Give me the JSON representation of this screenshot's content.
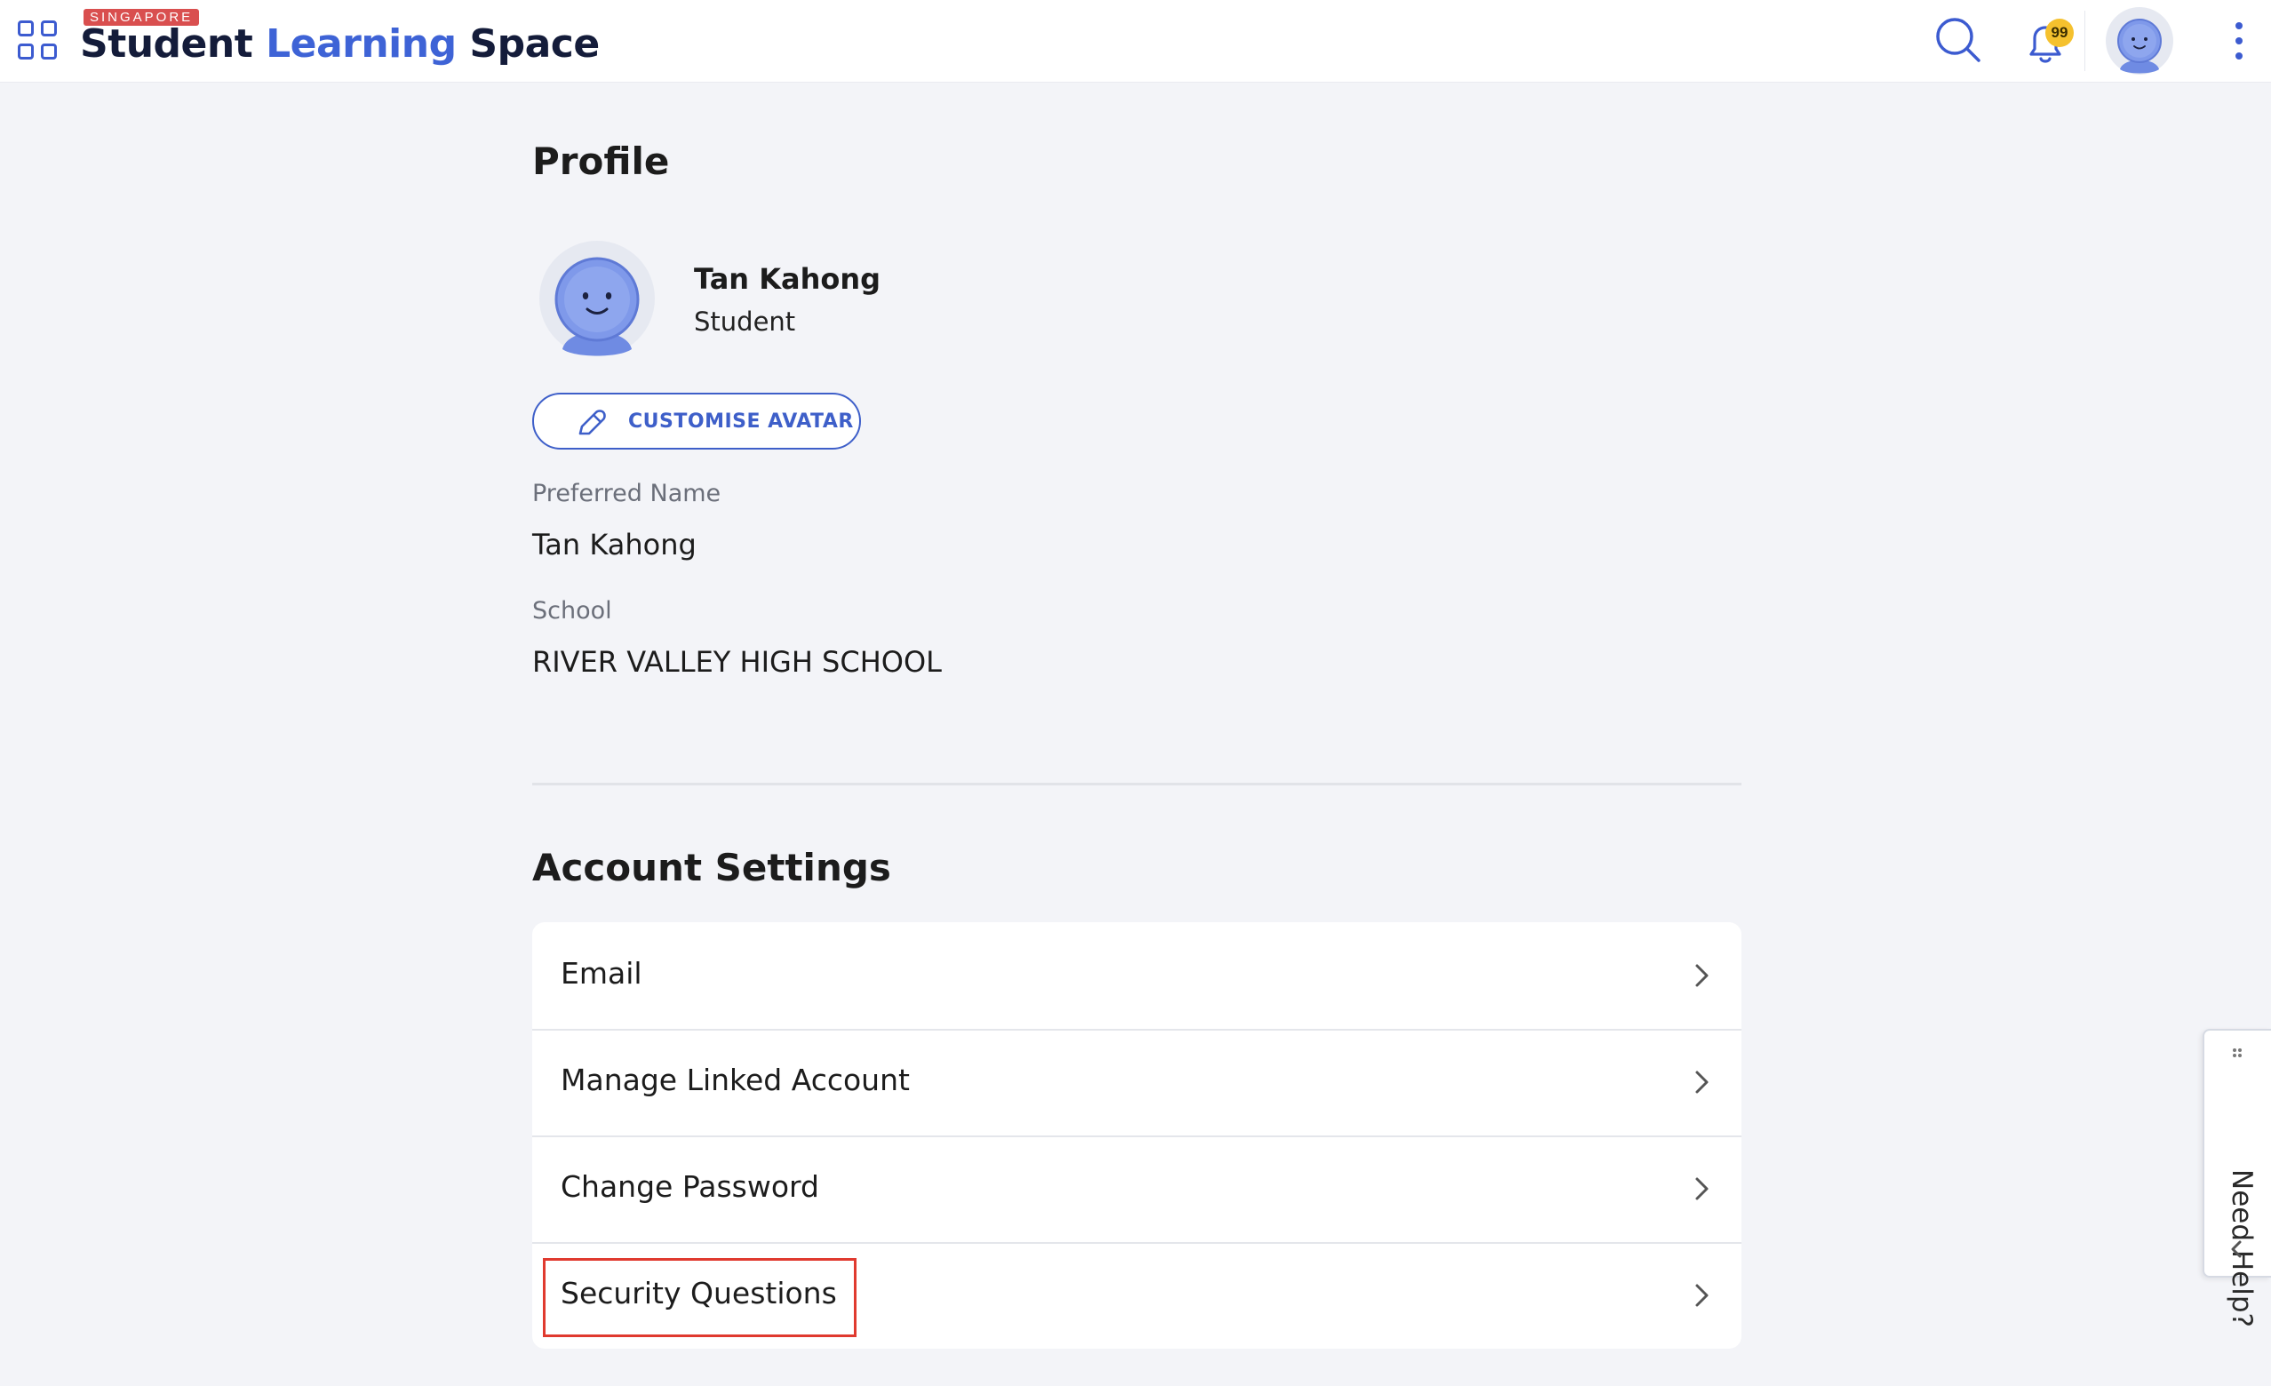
{
  "header": {
    "logo_badge": "SINGAPORE",
    "logo_word_1": "Student",
    "logo_word_2": "Learning",
    "logo_word_3": "Space",
    "notification_count": "99",
    "icons": {
      "apps": "apps-grid-icon",
      "search": "search-icon",
      "notifications": "bell-icon",
      "avatar": "avatar-icon",
      "menu": "kebab-menu-icon"
    }
  },
  "profile": {
    "heading": "Profile",
    "name": "Tan Kahong",
    "role": "Student",
    "customise_button": "CUSTOMISE AVATAR",
    "fields": [
      {
        "label": "Preferred Name",
        "value": "Tan Kahong"
      },
      {
        "label": "School",
        "value": "RIVER VALLEY HIGH SCHOOL"
      }
    ]
  },
  "account_settings": {
    "heading": "Account Settings",
    "items": [
      {
        "label": "Email"
      },
      {
        "label": "Manage Linked Account"
      },
      {
        "label": "Change Password"
      },
      {
        "label": "Security Questions",
        "highlighted": true
      }
    ]
  },
  "help_tab": {
    "label": "Need Help?"
  },
  "colors": {
    "brand_blue": "#3e63d6",
    "navy": "#141c3a",
    "badge_red": "#d94f4f",
    "notification_yellow": "#f5c12e",
    "highlight_red": "#e03a2f",
    "page_background": "#f3f4f8"
  }
}
